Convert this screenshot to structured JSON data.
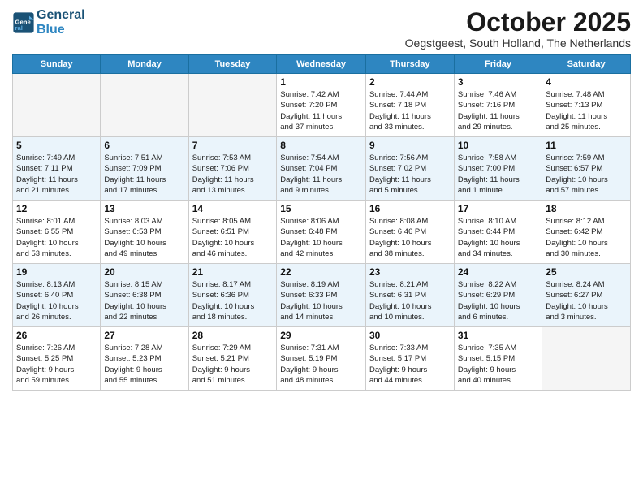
{
  "header": {
    "logo_line1": "General",
    "logo_line2": "Blue",
    "month": "October 2025",
    "location": "Oegstgeest, South Holland, The Netherlands"
  },
  "days_of_week": [
    "Sunday",
    "Monday",
    "Tuesday",
    "Wednesday",
    "Thursday",
    "Friday",
    "Saturday"
  ],
  "weeks": [
    [
      {
        "day": "",
        "info": ""
      },
      {
        "day": "",
        "info": ""
      },
      {
        "day": "",
        "info": ""
      },
      {
        "day": "1",
        "info": "Sunrise: 7:42 AM\nSunset: 7:20 PM\nDaylight: 11 hours\nand 37 minutes."
      },
      {
        "day": "2",
        "info": "Sunrise: 7:44 AM\nSunset: 7:18 PM\nDaylight: 11 hours\nand 33 minutes."
      },
      {
        "day": "3",
        "info": "Sunrise: 7:46 AM\nSunset: 7:16 PM\nDaylight: 11 hours\nand 29 minutes."
      },
      {
        "day": "4",
        "info": "Sunrise: 7:48 AM\nSunset: 7:13 PM\nDaylight: 11 hours\nand 25 minutes."
      }
    ],
    [
      {
        "day": "5",
        "info": "Sunrise: 7:49 AM\nSunset: 7:11 PM\nDaylight: 11 hours\nand 21 minutes."
      },
      {
        "day": "6",
        "info": "Sunrise: 7:51 AM\nSunset: 7:09 PM\nDaylight: 11 hours\nand 17 minutes."
      },
      {
        "day": "7",
        "info": "Sunrise: 7:53 AM\nSunset: 7:06 PM\nDaylight: 11 hours\nand 13 minutes."
      },
      {
        "day": "8",
        "info": "Sunrise: 7:54 AM\nSunset: 7:04 PM\nDaylight: 11 hours\nand 9 minutes."
      },
      {
        "day": "9",
        "info": "Sunrise: 7:56 AM\nSunset: 7:02 PM\nDaylight: 11 hours\nand 5 minutes."
      },
      {
        "day": "10",
        "info": "Sunrise: 7:58 AM\nSunset: 7:00 PM\nDaylight: 11 hours\nand 1 minute."
      },
      {
        "day": "11",
        "info": "Sunrise: 7:59 AM\nSunset: 6:57 PM\nDaylight: 10 hours\nand 57 minutes."
      }
    ],
    [
      {
        "day": "12",
        "info": "Sunrise: 8:01 AM\nSunset: 6:55 PM\nDaylight: 10 hours\nand 53 minutes."
      },
      {
        "day": "13",
        "info": "Sunrise: 8:03 AM\nSunset: 6:53 PM\nDaylight: 10 hours\nand 49 minutes."
      },
      {
        "day": "14",
        "info": "Sunrise: 8:05 AM\nSunset: 6:51 PM\nDaylight: 10 hours\nand 46 minutes."
      },
      {
        "day": "15",
        "info": "Sunrise: 8:06 AM\nSunset: 6:48 PM\nDaylight: 10 hours\nand 42 minutes."
      },
      {
        "day": "16",
        "info": "Sunrise: 8:08 AM\nSunset: 6:46 PM\nDaylight: 10 hours\nand 38 minutes."
      },
      {
        "day": "17",
        "info": "Sunrise: 8:10 AM\nSunset: 6:44 PM\nDaylight: 10 hours\nand 34 minutes."
      },
      {
        "day": "18",
        "info": "Sunrise: 8:12 AM\nSunset: 6:42 PM\nDaylight: 10 hours\nand 30 minutes."
      }
    ],
    [
      {
        "day": "19",
        "info": "Sunrise: 8:13 AM\nSunset: 6:40 PM\nDaylight: 10 hours\nand 26 minutes."
      },
      {
        "day": "20",
        "info": "Sunrise: 8:15 AM\nSunset: 6:38 PM\nDaylight: 10 hours\nand 22 minutes."
      },
      {
        "day": "21",
        "info": "Sunrise: 8:17 AM\nSunset: 6:36 PM\nDaylight: 10 hours\nand 18 minutes."
      },
      {
        "day": "22",
        "info": "Sunrise: 8:19 AM\nSunset: 6:33 PM\nDaylight: 10 hours\nand 14 minutes."
      },
      {
        "day": "23",
        "info": "Sunrise: 8:21 AM\nSunset: 6:31 PM\nDaylight: 10 hours\nand 10 minutes."
      },
      {
        "day": "24",
        "info": "Sunrise: 8:22 AM\nSunset: 6:29 PM\nDaylight: 10 hours\nand 6 minutes."
      },
      {
        "day": "25",
        "info": "Sunrise: 8:24 AM\nSunset: 6:27 PM\nDaylight: 10 hours\nand 3 minutes."
      }
    ],
    [
      {
        "day": "26",
        "info": "Sunrise: 7:26 AM\nSunset: 5:25 PM\nDaylight: 9 hours\nand 59 minutes."
      },
      {
        "day": "27",
        "info": "Sunrise: 7:28 AM\nSunset: 5:23 PM\nDaylight: 9 hours\nand 55 minutes."
      },
      {
        "day": "28",
        "info": "Sunrise: 7:29 AM\nSunset: 5:21 PM\nDaylight: 9 hours\nand 51 minutes."
      },
      {
        "day": "29",
        "info": "Sunrise: 7:31 AM\nSunset: 5:19 PM\nDaylight: 9 hours\nand 48 minutes."
      },
      {
        "day": "30",
        "info": "Sunrise: 7:33 AM\nSunset: 5:17 PM\nDaylight: 9 hours\nand 44 minutes."
      },
      {
        "day": "31",
        "info": "Sunrise: 7:35 AM\nSunset: 5:15 PM\nDaylight: 9 hours\nand 40 minutes."
      },
      {
        "day": "",
        "info": ""
      }
    ]
  ]
}
